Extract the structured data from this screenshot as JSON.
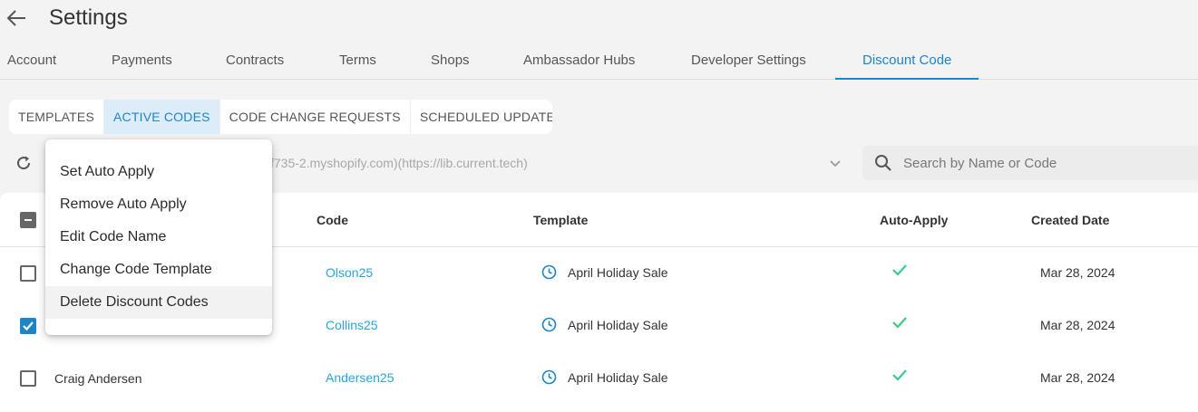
{
  "header": {
    "title": "Settings"
  },
  "main_tabs": [
    {
      "label": "Account"
    },
    {
      "label": "Payments"
    },
    {
      "label": "Contracts"
    },
    {
      "label": "Terms"
    },
    {
      "label": "Shops"
    },
    {
      "label": "Ambassador Hubs"
    },
    {
      "label": "Developer Settings"
    },
    {
      "label": "Discount Code",
      "active": true
    }
  ],
  "sub_tabs": [
    {
      "label": "TEMPLATES"
    },
    {
      "label": "ACTIVE CODES",
      "active": true
    },
    {
      "label": "CODE CHANGE REQUESTS"
    },
    {
      "label": "SCHEDULED UPDATES"
    }
  ],
  "shop_select": {
    "value": "f735-2.myshopify.com)(https://lib.current.tech)"
  },
  "search": {
    "placeholder": "Search by Name or Code",
    "value": ""
  },
  "table": {
    "columns": {
      "code": "Code",
      "template": "Template",
      "auto_apply": "Auto-Apply",
      "created": "Created Date"
    },
    "rows": [
      {
        "name": "",
        "code": "Olson25",
        "template": "April Holiday Sale",
        "auto_apply": true,
        "created": "Mar 28, 2024",
        "checked": false
      },
      {
        "name": "",
        "code": "Collins25",
        "template": "April Holiday Sale",
        "auto_apply": true,
        "created": "Mar 28, 2024",
        "checked": true
      },
      {
        "name": "Craig Andersen",
        "code": "Andersen25",
        "template": "April Holiday Sale",
        "auto_apply": true,
        "created": "Mar 28, 2024",
        "checked": false
      }
    ]
  },
  "context_menu": {
    "items": [
      {
        "label": "Set Auto Apply"
      },
      {
        "label": "Remove Auto Apply"
      },
      {
        "label": "Edit Code Name"
      },
      {
        "label": "Change Code Template"
      },
      {
        "label": "Delete Discount Codes",
        "hover": true
      }
    ]
  },
  "colors": {
    "accent": "#1e84c8",
    "link": "#28a6d8",
    "success": "#3ec98a"
  }
}
